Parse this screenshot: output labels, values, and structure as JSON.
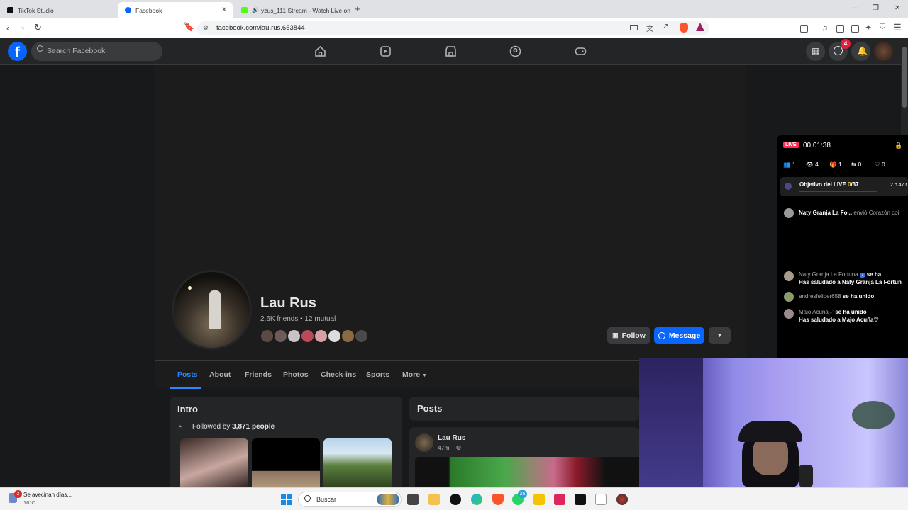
{
  "browser": {
    "tabs": [
      {
        "title": "TikTok Studio",
        "active": false
      },
      {
        "title": "Facebook",
        "active": true
      },
      {
        "title": "yzus_111 Stream - Watch Live on",
        "active": false
      }
    ],
    "url": "facebook.com/lau.rus.653844"
  },
  "fb_header": {
    "logo": "f",
    "search_placeholder": "Search Facebook",
    "messenger_badge": "4"
  },
  "profile": {
    "name": "Lau Rus",
    "friends_line": "2.6K friends • 12 mutual",
    "follow_label": "Follow",
    "message_label": "Message",
    "tabs": [
      "Posts",
      "About",
      "Friends",
      "Photos",
      "Check-ins",
      "Sports",
      "More"
    ]
  },
  "intro": {
    "title": "Intro",
    "followed_prefix": "Followed by ",
    "followed_count": "3,871 people"
  },
  "posts": {
    "title": "Posts",
    "author": "Lau Rus",
    "time": "47m ·"
  },
  "live_panel": {
    "live_badge": "LIVE",
    "timer": "00:01:38",
    "stats": [
      "1",
      "4",
      "1",
      "0",
      "0"
    ],
    "goal_label": "Objetivo del LIVE ",
    "goal_progress": "0",
    "goal_total": "/37",
    "goal_time": "2 h 47 r",
    "gift_user": "Naty Granja La Fo...",
    "gift_text": "envió Corazón coi",
    "chat": [
      {
        "user": "Naty Granja La Fortuna",
        "level": "7",
        "text": "se ha",
        "line2": "Has saludado a Naty Granja La Fortun"
      },
      {
        "user": "andresfeliper658",
        "text": "se ha unido",
        "line2": ""
      },
      {
        "user": "Majo Acuña♡",
        "text": "se ha unido",
        "line2": "Has saludado a Majo Acuña♡"
      }
    ]
  },
  "taskbar": {
    "weather_text": "Se avecinan días...",
    "temperature": "16°C",
    "weather_badge": "2",
    "search_label": "Buscar",
    "whatsapp_badge": "25"
  }
}
